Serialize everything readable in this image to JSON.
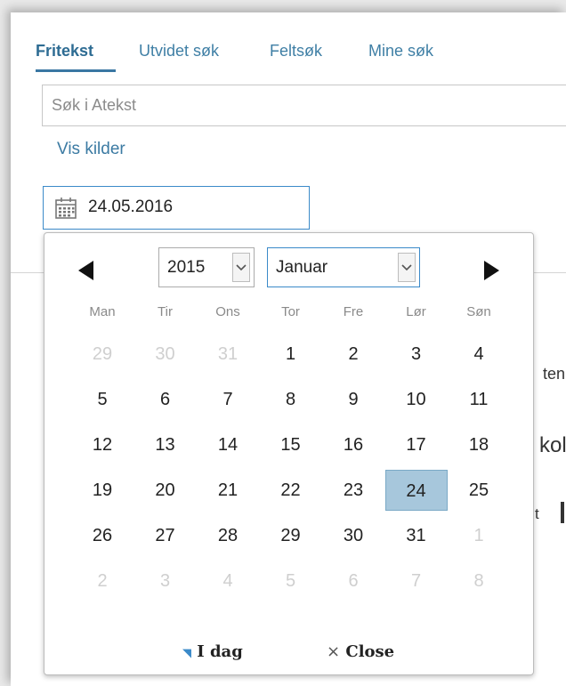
{
  "tabs": [
    {
      "label": "Fritekst",
      "active": true
    },
    {
      "label": "Utvidet søk",
      "active": false
    },
    {
      "label": "Feltsøk",
      "active": false
    },
    {
      "label": "Mine søk",
      "active": false
    }
  ],
  "search": {
    "placeholder": "Søk i Atekst",
    "value": ""
  },
  "vis_kilder": "Vis kilder",
  "date_field": {
    "icon": "calendar-icon",
    "value": "24.05.2016"
  },
  "background_fragments": [
    "ten",
    "kol",
    "t"
  ],
  "calendar": {
    "year": "2015",
    "month": "Januar",
    "weekdays": [
      "Man",
      "Tir",
      "Ons",
      "Tor",
      "Fre",
      "Lør",
      "Søn"
    ],
    "weeks": [
      [
        {
          "d": "29",
          "o": true
        },
        {
          "d": "30",
          "o": true
        },
        {
          "d": "31",
          "o": true
        },
        {
          "d": "1"
        },
        {
          "d": "2"
        },
        {
          "d": "3"
        },
        {
          "d": "4"
        }
      ],
      [
        {
          "d": "5"
        },
        {
          "d": "6"
        },
        {
          "d": "7"
        },
        {
          "d": "8"
        },
        {
          "d": "9"
        },
        {
          "d": "10"
        },
        {
          "d": "11"
        }
      ],
      [
        {
          "d": "12"
        },
        {
          "d": "13"
        },
        {
          "d": "14"
        },
        {
          "d": "15"
        },
        {
          "d": "16"
        },
        {
          "d": "17"
        },
        {
          "d": "18"
        }
      ],
      [
        {
          "d": "19"
        },
        {
          "d": "20"
        },
        {
          "d": "21"
        },
        {
          "d": "22"
        },
        {
          "d": "23"
        },
        {
          "d": "24",
          "s": true
        },
        {
          "d": "25"
        }
      ],
      [
        {
          "d": "26"
        },
        {
          "d": "27"
        },
        {
          "d": "28"
        },
        {
          "d": "29"
        },
        {
          "d": "30"
        },
        {
          "d": "31"
        },
        {
          "d": "1",
          "o": true
        }
      ],
      [
        {
          "d": "2",
          "o": true
        },
        {
          "d": "3",
          "o": true
        },
        {
          "d": "4",
          "o": true
        },
        {
          "d": "5",
          "o": true
        },
        {
          "d": "6",
          "o": true
        },
        {
          "d": "7",
          "o": true
        },
        {
          "d": "8",
          "o": true
        }
      ]
    ],
    "today_label": "I dag",
    "close_label": "Close",
    "today_glyph": "◥",
    "close_glyph": "×",
    "selected_color": "#a7c7dc",
    "accent_color": "#3b8ac9"
  }
}
